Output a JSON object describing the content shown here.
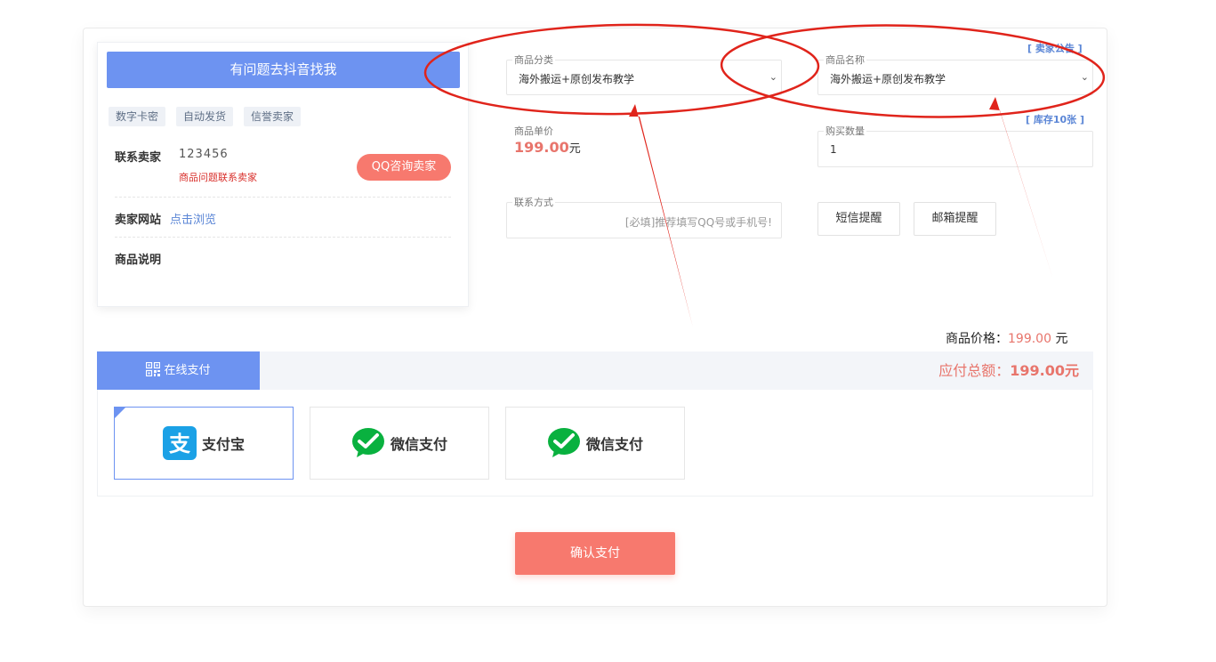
{
  "seller": {
    "banner": "有问题去抖音找我",
    "tags": [
      "数字卡密",
      "自动发货",
      "信誉卖家"
    ],
    "contact_label": "联系卖家",
    "contact_value": "123456",
    "contact_note": "商品问题联系卖家",
    "qq_button": "QQ咨询卖家",
    "site_label": "卖家网站",
    "site_link": "点击浏览",
    "desc_label": "商品说明"
  },
  "form": {
    "category_label": "商品分类",
    "category_value": "海外搬运+原创发布教学",
    "name_label": "商品名称",
    "name_value": "海外搬运+原创发布教学",
    "notice_link": "[ 卖家公告 ]",
    "stock_link": "[ 库存10张 ]",
    "unit_price_label": "商品单价",
    "unit_price": "199.00",
    "unit_price_suffix": "元",
    "qty_label": "购买数量",
    "qty_value": "1",
    "contact_label": "联系方式",
    "contact_placeholder": "[必填]推荐填写QQ号或手机号!",
    "sms_button": "短信提醒",
    "email_button": "邮箱提醒"
  },
  "summary": {
    "goods_price_label": "商品价格：",
    "goods_price": "199.00",
    "goods_price_unit": " 元",
    "total_label": "应付总额：",
    "total_value": "199.00",
    "total_unit": "元"
  },
  "payment": {
    "tab_label": "在线支付",
    "methods": [
      {
        "label": "支付宝",
        "icon": "alipay-icon"
      },
      {
        "label": "微信支付",
        "icon": "wechat-pay-icon"
      },
      {
        "label": "微信支付",
        "icon": "wechat-pay-icon"
      }
    ],
    "confirm_button": "确认支付"
  },
  "colors": {
    "accent_blue": "#6d93f1",
    "accent_coral": "#f7796e",
    "price_red": "#e8756c",
    "annotation_red": "#e0241b"
  }
}
